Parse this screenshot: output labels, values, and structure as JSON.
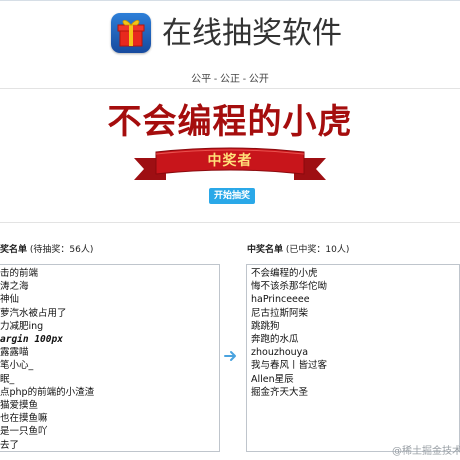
{
  "header": {
    "title": "在线抽奖软件",
    "subtitle": "公平 - 公正 - 公开"
  },
  "draw": {
    "winner": "不会编程的小虎",
    "ribbon_text": "中奖者",
    "start_button": "开始抽奖"
  },
  "candidates": {
    "title": "奖名单",
    "status": "(待抽奖：56人)",
    "items": [
      "击的前端",
      "涛之海",
      "神仙",
      "萝汽水被占用了",
      "力减肥ing",
      "argin 100px",
      "露露喵",
      "笔小心_",
      "眠_",
      "点php的前端的小渣渣",
      "猫爱摸鱼",
      "也在摸鱼嘛",
      "是一只鱼吖",
      "去了"
    ]
  },
  "winners": {
    "title": "中奖名单",
    "status": "(已中奖：10人)",
    "items": [
      "不会编程的小虎",
      "悔不该杀那华佗呦",
      "haPrinceeee",
      "尼古拉斯阿柴",
      "跳跳狗",
      "奔跑的水瓜",
      "zhouzhouya",
      "我与春风丨皆过客",
      "Allen星辰",
      "掘金齐天大圣"
    ]
  },
  "watermark": "@稀土掘金技术",
  "colors": {
    "winner_red": "#a50d0d",
    "button_blue": "#2aa8e8",
    "ribbon_red": "#c8151b",
    "ribbon_gold": "#ffe07a"
  },
  "icons": {
    "app": "gift-box-icon",
    "transfer": "arrow-right-icon"
  }
}
